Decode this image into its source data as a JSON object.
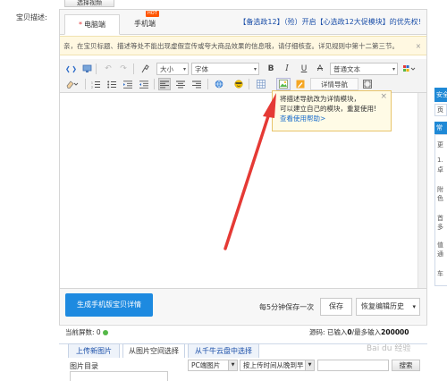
{
  "top_button": "选择视频",
  "field_label": "宝贝描述:",
  "tabs": {
    "pc_star": "*",
    "pc": "电脑端",
    "mobile": "手机端",
    "hot": "HOT",
    "notice": "【备选政12】（殓）开启【心选政12大促模块】的优先权!"
  },
  "warning": {
    "text": "亲，在宝贝标题、描述等处不能出现虚假宣传或夸大商品效果的信息哦，请仔细核查。详见规则中第十二第三节。",
    "close": "×"
  },
  "toolbar": {
    "font_size": "大小",
    "font_family": "字体",
    "bold": "B",
    "italic": "I",
    "underline": "U",
    "strike": "A",
    "paragraph": "普通文本",
    "detail_nav": "详情导航",
    "row1_icons": [
      "source-icon",
      "preview-icon",
      "undo-icon",
      "redo-icon",
      "format-brush-icon"
    ],
    "row2_icons": [
      "eraser-icon",
      "ordered-list-icon",
      "unordered-list-icon",
      "indent-icon",
      "outdent-icon",
      "align-left-icon",
      "align-center-icon",
      "align-right-icon",
      "link-icon",
      "emoticon-icon",
      "table-icon",
      "image-icon",
      "edit-icon",
      "fullscreen-icon"
    ]
  },
  "tooltip": {
    "line1": "将描述导航改为详情模块，",
    "line2": "可以建立自己的模块，重复使用!",
    "link": "查看使用帮助>",
    "close": "×"
  },
  "editor_bottom": {
    "generate_mobile": "生成手机版宝贝详情",
    "autosave": "每5分钟保存一次",
    "save": "保存",
    "restore": "恢复编辑历史"
  },
  "status": {
    "screens": "当前屏数: 0",
    "chars_prefix": "源码: 已输入",
    "chars_value": "0",
    "chars_mid": "/最多输入",
    "chars_max": "200000"
  },
  "image_panel": {
    "tabs": [
      "上传新图片",
      "从图片空间选择",
      "从千牛云盘中选择"
    ],
    "active_tab": 1,
    "dir_label": "图片目录",
    "filter_type": "PC端图片",
    "filter_sort": "按上传时间从晚到早",
    "search_button": "搜索",
    "watermark": "Bai du 经验"
  },
  "right_panel": {
    "head": "安全",
    "sub": "页面",
    "head2": "常见",
    "lines": [
      "更",
      "1.",
      "卓",
      "附",
      "色",
      "首",
      "多",
      "值",
      "通",
      "车"
    ]
  },
  "colors": {
    "accent_blue": "#1d8ae0",
    "warning_bg": "#fff8e1",
    "arrow_red": "#e53a35"
  }
}
